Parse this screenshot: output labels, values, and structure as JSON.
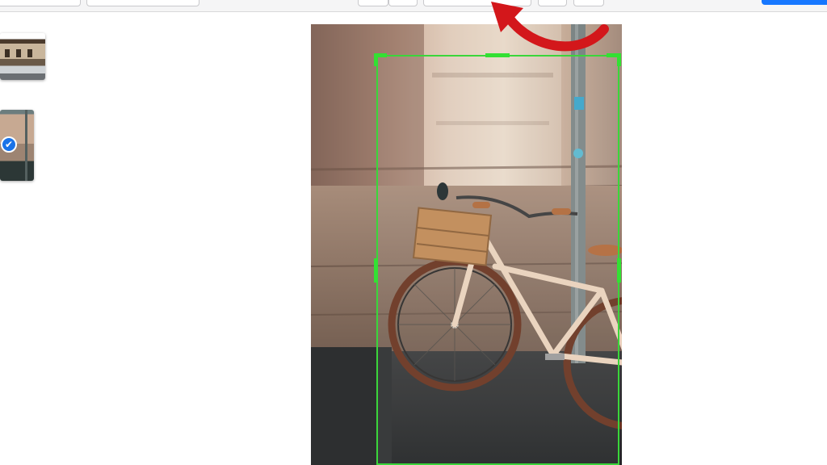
{
  "toolbar": {
    "accent_color": "#1677ff",
    "icons": [
      "image-icon",
      "info-icon",
      "square-icon",
      "globe-icon"
    ]
  },
  "thumbnails": [
    {
      "selected": false
    },
    {
      "selected": true,
      "check_icon": "checkmark-icon"
    }
  ],
  "selection": {
    "check_glyph": "✔"
  },
  "crop": {
    "border_color": "#3ad63a"
  },
  "annotation": {
    "arrow_color": "#d3171b"
  }
}
